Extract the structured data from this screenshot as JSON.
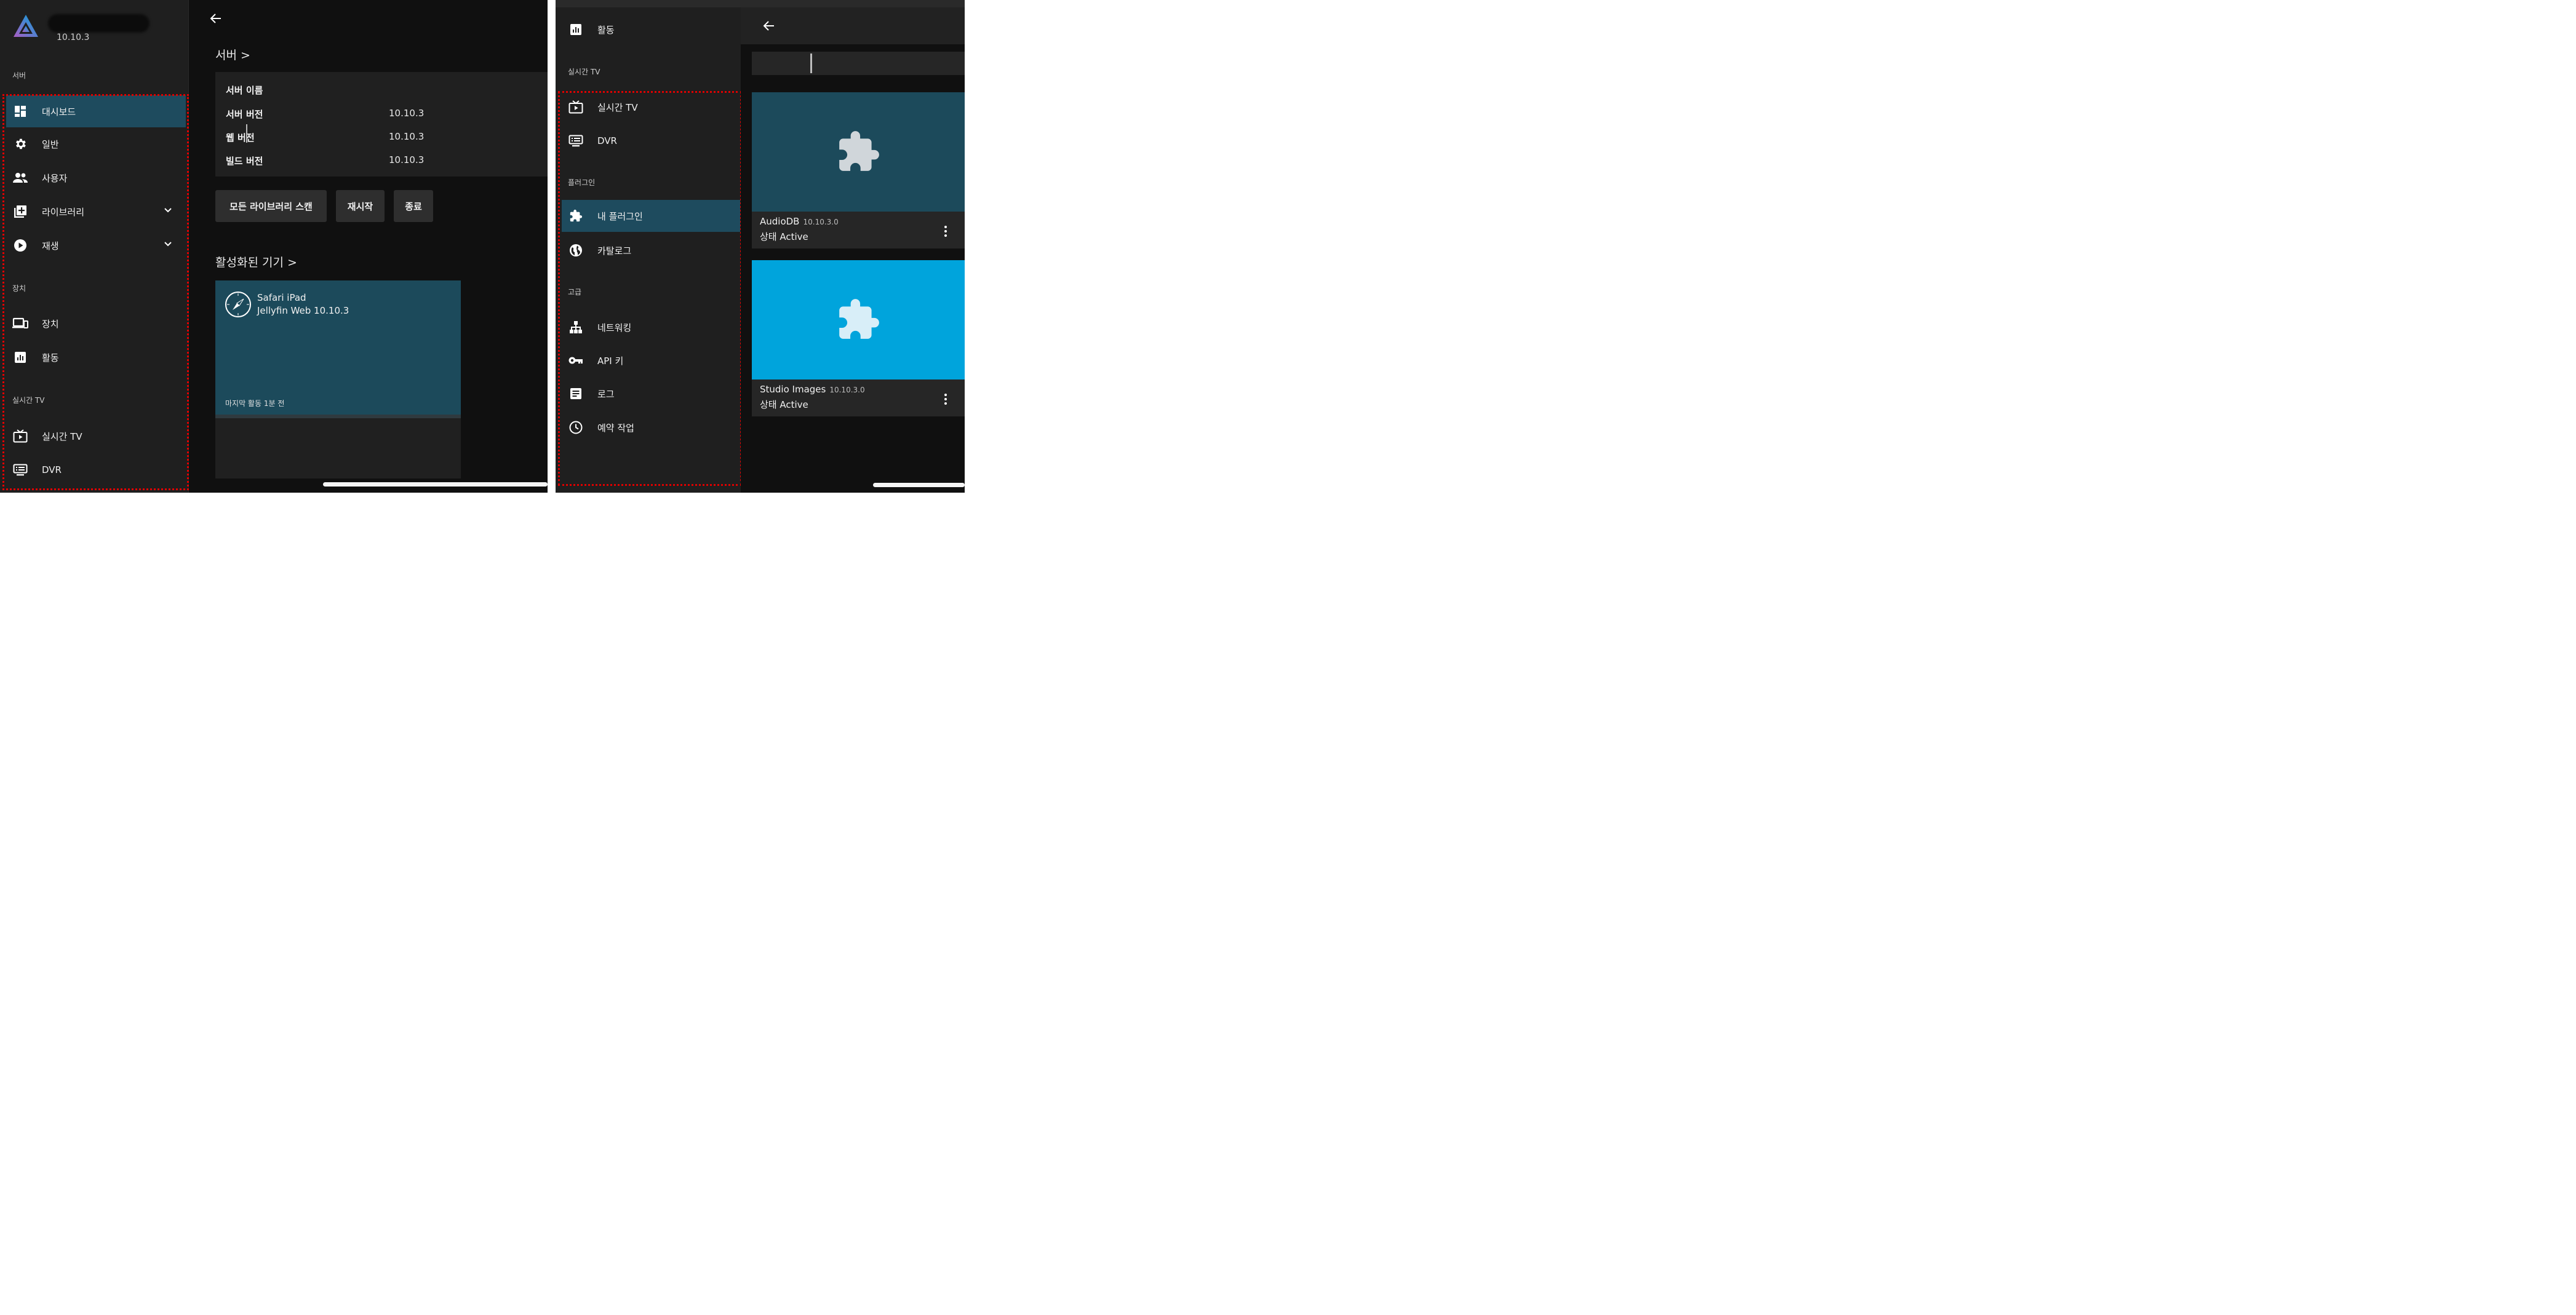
{
  "left": {
    "sidebar": {
      "version": "10.10.3",
      "section_server": "서버",
      "items": [
        {
          "label": "대시보드",
          "icon": "dashboard-icon",
          "active": true
        },
        {
          "label": "일반",
          "icon": "gear-icon"
        },
        {
          "label": "사용자",
          "icon": "users-icon"
        },
        {
          "label": "라이브러리",
          "icon": "library-add-icon",
          "expandable": true
        },
        {
          "label": "재생",
          "icon": "play-circle-icon",
          "expandable": true
        }
      ],
      "section_devices": "장치",
      "device_items": [
        {
          "label": "장치",
          "icon": "devices-icon"
        },
        {
          "label": "활동",
          "icon": "activity-icon"
        }
      ],
      "section_livetv": "실시간 TV",
      "livetv_items": [
        {
          "label": "실시간 TV",
          "icon": "live-tv-icon"
        },
        {
          "label": "DVR",
          "icon": "dvr-icon"
        }
      ]
    },
    "main": {
      "server_section_title": "서버 >",
      "server_info": {
        "name_label": "서버 이름",
        "server_version_label": "서버 버전",
        "server_version": "10.10.3",
        "web_version_label": "웹 버전",
        "web_version": "10.10.3",
        "build_version_label": "빌드 버전",
        "build_version": "10.10.3"
      },
      "buttons": {
        "scan_all": "모든 라이브러리 스캔",
        "restart": "재시작",
        "shutdown": "종료"
      },
      "active_devices_title": "활성화된 기기 >",
      "device": {
        "name": "Safari iPad",
        "client": "Jellyfin Web 10.10.3",
        "last_active": "마지막 활동 1분 전",
        "icon": "safari-compass-icon"
      }
    }
  },
  "right": {
    "sidebar": {
      "top_item": {
        "label": "활동",
        "icon": "activity-icon"
      },
      "section_livetv": "실시간 TV",
      "livetv_items": [
        {
          "label": "실시간 TV",
          "icon": "live-tv-icon"
        },
        {
          "label": "DVR",
          "icon": "dvr-icon"
        }
      ],
      "section_plugins": "플러그인",
      "plugin_items": [
        {
          "label": "내 플러그인",
          "icon": "puzzle-icon",
          "active": true
        },
        {
          "label": "카탈로그",
          "icon": "globe-icon"
        }
      ],
      "section_advanced": "고급",
      "advanced_items": [
        {
          "label": "네트워킹",
          "icon": "network-icon"
        },
        {
          "label": "API 키",
          "icon": "key-icon"
        },
        {
          "label": "로그",
          "icon": "log-icon"
        },
        {
          "label": "예약 작업",
          "icon": "clock-icon"
        }
      ]
    },
    "plugins": [
      {
        "name": "AudioDB",
        "version": "10.10.3.0",
        "status": "상태 Active",
        "color": "#1c4a5b",
        "icon_color": "#d0d6da"
      },
      {
        "name": "Studio Images",
        "version": "10.10.3.0",
        "status": "상태 Active",
        "color": "#00a4dc",
        "icon_color": "#d8eef8"
      }
    ]
  },
  "colors": {
    "accent": "#1e4b5e",
    "highlight_border": "#e00000"
  }
}
